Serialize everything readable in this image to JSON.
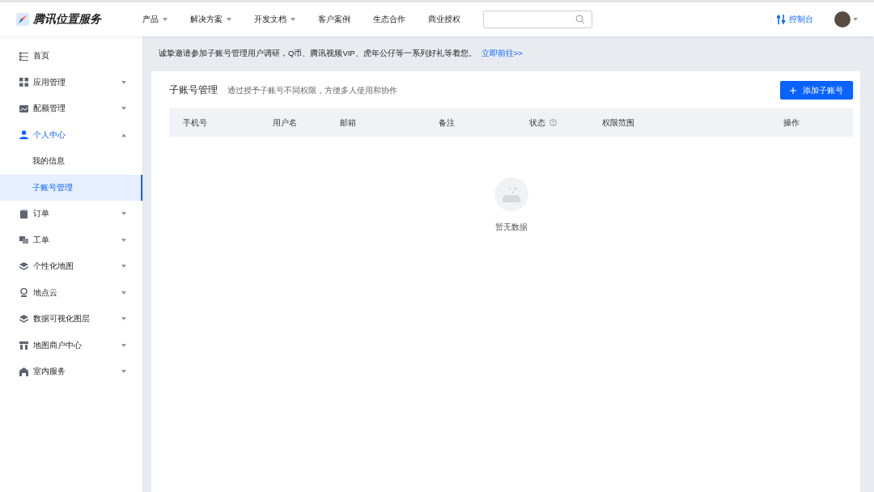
{
  "header": {
    "logo": "腾讯位置服务",
    "nav": [
      {
        "label": "产品",
        "dropdown": true
      },
      {
        "label": "解决方案",
        "dropdown": true
      },
      {
        "label": "开发文档",
        "dropdown": true
      },
      {
        "label": "客户案例",
        "dropdown": false
      },
      {
        "label": "生态合作",
        "dropdown": false
      },
      {
        "label": "商业授权",
        "dropdown": false
      }
    ],
    "console": "控制台"
  },
  "sidebar": {
    "items": [
      {
        "label": "首页",
        "selected": false
      },
      {
        "label": "应用管理",
        "selected": false,
        "expanded": false
      },
      {
        "label": "配额管理",
        "selected": false,
        "expanded": false
      },
      {
        "label": "个人中心",
        "selected": true,
        "expanded": true,
        "children": [
          {
            "label": "我的信息",
            "selected": false
          },
          {
            "label": "子账号管理",
            "selected": true
          }
        ]
      },
      {
        "label": "订单",
        "selected": false,
        "expanded": false
      },
      {
        "label": "工单",
        "selected": false,
        "expanded": false
      },
      {
        "label": "个性化地图",
        "selected": false,
        "expanded": false
      },
      {
        "label": "地点云",
        "selected": false,
        "expanded": false
      },
      {
        "label": "数据可视化图层",
        "selected": false,
        "expanded": false
      },
      {
        "label": "地图商户中心",
        "selected": false,
        "expanded": false
      },
      {
        "label": "室内服务",
        "selected": false,
        "expanded": false
      }
    ]
  },
  "banner": {
    "text": "诚挚邀请参加子账号管理用户调研，Q币、腾讯视频VIP、虎年公仔等一系列好礼等着您。",
    "link": "立即前往>>"
  },
  "panel": {
    "title": "子账号管理",
    "subtitle": "通过授予子账号不同权限，方便多人使用和协作",
    "add_button": "添加子账号",
    "table": {
      "columns": [
        {
          "label": "手机号",
          "help": false
        },
        {
          "label": "用户名",
          "help": false
        },
        {
          "label": "邮箱",
          "help": false
        },
        {
          "label": "备注",
          "help": false
        },
        {
          "label": "状态",
          "help": true
        },
        {
          "label": "权限范围",
          "help": false
        },
        {
          "label": "操作",
          "help": false
        }
      ],
      "empty": "暂无数据"
    }
  }
}
